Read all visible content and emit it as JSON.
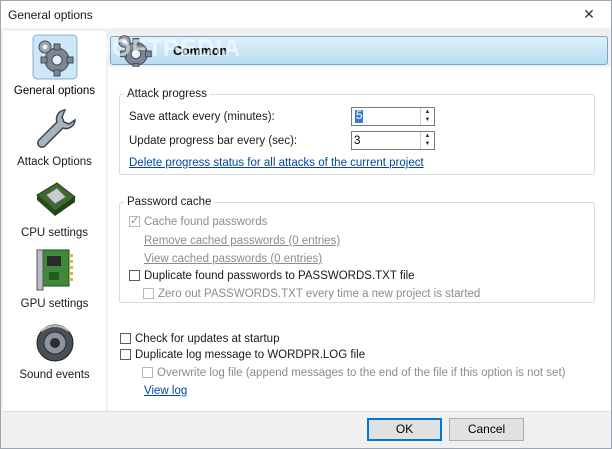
{
  "window": {
    "title": "General options",
    "close_glyph": "✕"
  },
  "watermark": "SOFTPEDIA",
  "sidebar": {
    "items": [
      {
        "label": "General options",
        "icon": "gear-icon",
        "selected": true
      },
      {
        "label": "Attack Options",
        "icon": "wrench-icon",
        "selected": false
      },
      {
        "label": "CPU settings",
        "icon": "cpu-icon",
        "selected": false
      },
      {
        "label": "GPU settings",
        "icon": "gpu-card-icon",
        "selected": false
      },
      {
        "label": "Sound events",
        "icon": "speaker-icon",
        "selected": false
      }
    ]
  },
  "header": {
    "title": "Common",
    "icon": "gear-icon"
  },
  "attack_progress": {
    "legend": "Attack progress",
    "save_label": "Save attack every (minutes):",
    "save_value": "5",
    "update_label": "Update progress bar every (sec):",
    "update_value": "3",
    "delete_link": "Delete progress status for all attacks of the current project"
  },
  "password_cache": {
    "legend": "Password cache",
    "cache_found": {
      "label": "Cache found passwords",
      "checked": true,
      "enabled": false
    },
    "remove_link": "Remove cached passwords  (0 entries)",
    "view_link": "View cached passwords  (0 entries)",
    "duplicate": {
      "label": "Duplicate found passwords to PASSWORDS.TXT file",
      "checked": false,
      "enabled": true
    },
    "zero_out": {
      "label": "Zero out PASSWORDS.TXT every time a new project is started",
      "checked": false,
      "enabled": false
    }
  },
  "misc": {
    "check_updates": {
      "label": "Check for updates at startup",
      "checked": false
    },
    "duplicate_log": {
      "label": "Duplicate log message to WORDPR.LOG file",
      "checked": false
    },
    "overwrite_log": {
      "label": "Overwrite log file (append messages to the end of the file if this option is not set)",
      "checked": false,
      "enabled": false
    },
    "view_log": "View log"
  },
  "buttons": {
    "ok": "OK",
    "cancel": "Cancel"
  },
  "colors": {
    "link": "#0046a8",
    "banner_top": "#dff1fb",
    "banner_bottom": "#b9dcf0",
    "default_button_border": "#0078d7"
  }
}
